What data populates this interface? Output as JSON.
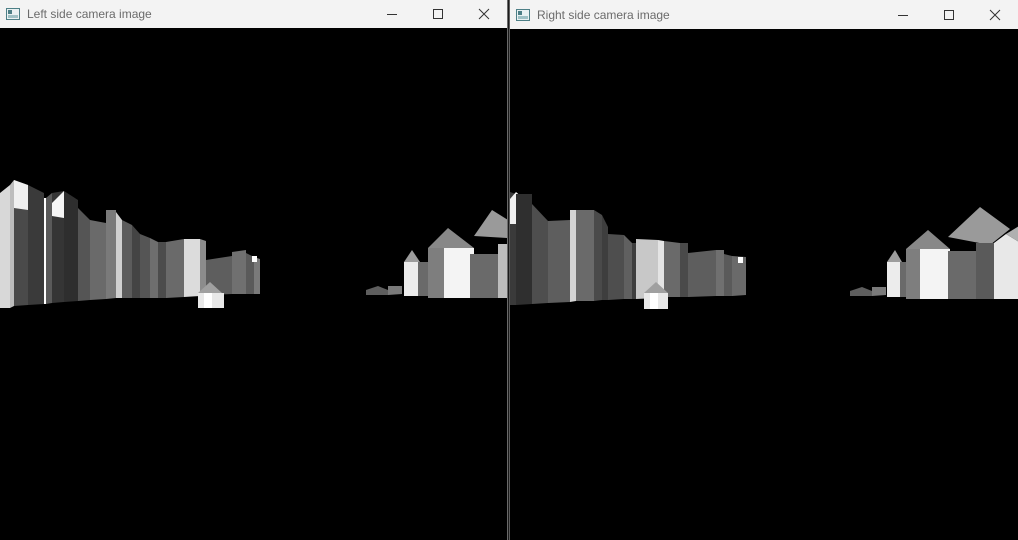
{
  "windows": {
    "left": {
      "title": "Left side camera image"
    },
    "right": {
      "title": "Right side camera image"
    }
  },
  "icons": {
    "app": "window-app-icon",
    "minimize": "minimize-icon",
    "maximize": "maximize-icon",
    "close": "close-icon"
  },
  "colors": {
    "titlebar": "#f3f3f3",
    "title_text": "#6b6b6b",
    "viewport_background": "#000000"
  }
}
